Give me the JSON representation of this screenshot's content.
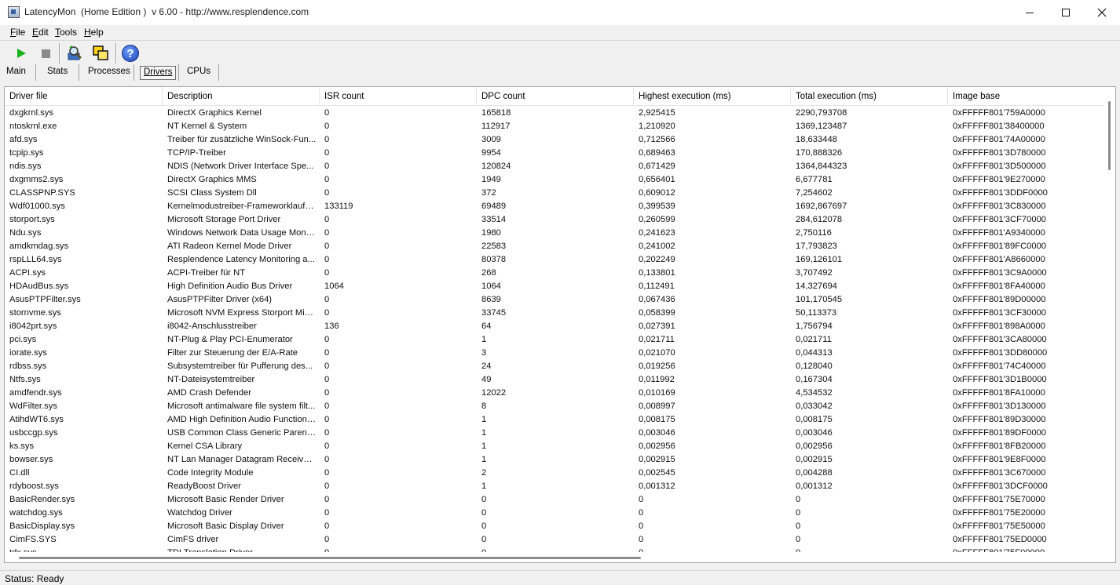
{
  "window": {
    "title": "LatencyMon  (Home Edition )  v 6.00 - http://www.resplendence.com"
  },
  "menu": [
    {
      "label_u": "F",
      "label_rest": "ile"
    },
    {
      "label_u": "E",
      "label_rest": "dit"
    },
    {
      "label_u": "T",
      "label_rest": "ools"
    },
    {
      "label_u": "H",
      "label_rest": "elp"
    }
  ],
  "toolbar": {
    "icons": [
      "play-icon",
      "stop-icon",
      "search-icon",
      "windows-icon",
      "help-icon"
    ],
    "help_glyph": "?"
  },
  "tabs": [
    {
      "label": "Main",
      "active": false
    },
    {
      "label": "Stats",
      "active": false
    },
    {
      "label": "Processes",
      "active": false
    },
    {
      "label": "Drivers",
      "active": true
    },
    {
      "label": "CPUs",
      "active": false
    }
  ],
  "table": {
    "columns": [
      "Driver file",
      "Description",
      "ISR count",
      "DPC count",
      "Highest execution (ms)",
      "Total execution (ms)",
      "Image base"
    ],
    "rows": [
      [
        "dxgkrnl.sys",
        "DirectX Graphics Kernel",
        "0",
        "165818",
        "2,925415",
        "2290,793708",
        "0xFFFFF801'759A0000"
      ],
      [
        "ntoskrnl.exe",
        "NT Kernel & System",
        "0",
        "112917",
        "1,210920",
        "1369,123487",
        "0xFFFFF801'38400000"
      ],
      [
        "afd.sys",
        "Treiber für zusätzliche WinSock-Fun...",
        "0",
        "3009",
        "0,712566",
        "18,633448",
        "0xFFFFF801'74A00000"
      ],
      [
        "tcpip.sys",
        "TCP/IP-Treiber",
        "0",
        "9954",
        "0,689463",
        "170,888326",
        "0xFFFFF801'3D780000"
      ],
      [
        "ndis.sys",
        "NDIS (Network Driver Interface Spe...",
        "0",
        "120824",
        "0,671429",
        "1364,844323",
        "0xFFFFF801'3D500000"
      ],
      [
        "dxgmms2.sys",
        "DirectX Graphics MMS",
        "0",
        "1949",
        "0,656401",
        "6,677781",
        "0xFFFFF801'9E270000"
      ],
      [
        "CLASSPNP.SYS",
        "SCSI Class System Dll",
        "0",
        "372",
        "0,609012",
        "7,254602",
        "0xFFFFF801'3DDF0000"
      ],
      [
        "Wdf01000.sys",
        "Kernelmodustreiber-Frameworklaufzeit",
        "133119",
        "69489",
        "0,399539",
        "1692,867697",
        "0xFFFFF801'3C830000"
      ],
      [
        "storport.sys",
        "Microsoft Storage Port Driver",
        "0",
        "33514",
        "0,260599",
        "284,612078",
        "0xFFFFF801'3CF70000"
      ],
      [
        "Ndu.sys",
        "Windows Network Data Usage Monit...",
        "0",
        "1980",
        "0,241623",
        "2,750116",
        "0xFFFFF801'A9340000"
      ],
      [
        "amdkmdag.sys",
        "ATI Radeon Kernel Mode Driver",
        "0",
        "22583",
        "0,241002",
        "17,793823",
        "0xFFFFF801'89FC0000"
      ],
      [
        "rspLLL64.sys",
        "Resplendence Latency Monitoring a...",
        "0",
        "80378",
        "0,202249",
        "169,126101",
        "0xFFFFF801'A8660000"
      ],
      [
        "ACPI.sys",
        "ACPI-Treiber für NT",
        "0",
        "268",
        "0,133801",
        "3,707492",
        "0xFFFFF801'3C9A0000"
      ],
      [
        "HDAudBus.sys",
        "High Definition Audio Bus Driver",
        "1064",
        "1064",
        "0,112491",
        "14,327694",
        "0xFFFFF801'8FA40000"
      ],
      [
        "AsusPTPFilter.sys",
        "AsusPTPFilter Driver (x64)",
        "0",
        "8639",
        "0,067436",
        "101,170545",
        "0xFFFFF801'89D00000"
      ],
      [
        "stornvme.sys",
        "Microsoft NVM Express Storport Mini...",
        "0",
        "33745",
        "0,058399",
        "50,113373",
        "0xFFFFF801'3CF30000"
      ],
      [
        "i8042prt.sys",
        "i8042-Anschlusstreiber",
        "136",
        "64",
        "0,027391",
        "1,756794",
        "0xFFFFF801'898A0000"
      ],
      [
        "pci.sys",
        "NT-Plug & Play PCI-Enumerator",
        "0",
        "1",
        "0,021711",
        "0,021711",
        "0xFFFFF801'3CA80000"
      ],
      [
        "iorate.sys",
        "Filter zur Steuerung der E/A-Rate",
        "0",
        "3",
        "0,021070",
        "0,044313",
        "0xFFFFF801'3DD80000"
      ],
      [
        "rdbss.sys",
        "Subsystemtreiber für Pufferung des...",
        "0",
        "24",
        "0,019256",
        "0,128040",
        "0xFFFFF801'74C40000"
      ],
      [
        "Ntfs.sys",
        "NT-Dateisystemtreiber",
        "0",
        "49",
        "0,011992",
        "0,167304",
        "0xFFFFF801'3D1B0000"
      ],
      [
        "amdfendr.sys",
        "AMD Crash Defender",
        "0",
        "12022",
        "0,010169",
        "4,534532",
        "0xFFFFF801'8FA10000"
      ],
      [
        "WdFilter.sys",
        "Microsoft antimalware file system filt...",
        "0",
        "8",
        "0,008997",
        "0,033042",
        "0xFFFFF801'3D130000"
      ],
      [
        "AtihdWT6.sys",
        "AMD High Definition Audio Function ...",
        "0",
        "1",
        "0,008175",
        "0,008175",
        "0xFFFFF801'89D30000"
      ],
      [
        "usbccgp.sys",
        "USB Common Class Generic Parent ...",
        "0",
        "1",
        "0,003046",
        "0,003046",
        "0xFFFFF801'89DF0000"
      ],
      [
        "ks.sys",
        "Kernel CSA Library",
        "0",
        "1",
        "0,002956",
        "0,002956",
        "0xFFFFF801'8FB20000"
      ],
      [
        "bowser.sys",
        "NT Lan Manager Datagram Receiver...",
        "0",
        "1",
        "0,002915",
        "0,002915",
        "0xFFFFF801'9E8F0000"
      ],
      [
        "CI.dll",
        "Code Integrity Module",
        "0",
        "2",
        "0,002545",
        "0,004288",
        "0xFFFFF801'3C670000"
      ],
      [
        "rdyboost.sys",
        "ReadyBoost Driver",
        "0",
        "1",
        "0,001312",
        "0,001312",
        "0xFFFFF801'3DCF0000"
      ],
      [
        "BasicRender.sys",
        "Microsoft Basic Render Driver",
        "0",
        "0",
        "0",
        "0",
        "0xFFFFF801'75E70000"
      ],
      [
        "watchdog.sys",
        "Watchdog Driver",
        "0",
        "0",
        "0",
        "0",
        "0xFFFFF801'75E20000"
      ],
      [
        "BasicDisplay.sys",
        "Microsoft Basic Display Driver",
        "0",
        "0",
        "0",
        "0",
        "0xFFFFF801'75E50000"
      ],
      [
        "CimFS.SYS",
        "CimFS driver",
        "0",
        "0",
        "0",
        "0",
        "0xFFFFF801'75ED0000"
      ],
      [
        "tdx.sys",
        "TDI Translation Driver",
        "0",
        "0",
        "0",
        "0",
        "0xFFFFF801'75F00000"
      ]
    ]
  },
  "status": {
    "text": "Status: Ready"
  }
}
